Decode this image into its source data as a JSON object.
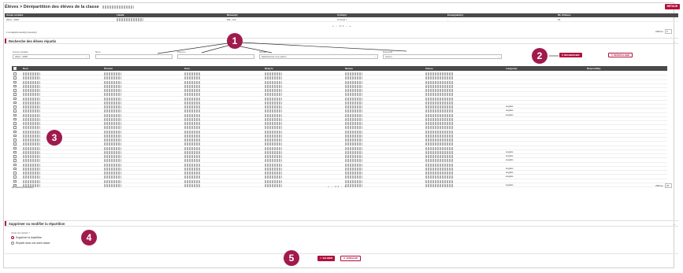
{
  "title": "Élèves > Dérépartition des élèves de la classe",
  "retour_label": "RETOUR",
  "class_grid": {
    "headers": [
      "Année scolaire",
      "Libellé",
      "Niveau(x)",
      "Cycle(s)",
      "Enseignant(s)",
      "Nb d'élèves"
    ],
    "row": [
      "2024 - 2025",
      "",
      "MS - GS",
      "CYCLE I",
      "-",
      "25"
    ]
  },
  "class_pager": {
    "first": "«",
    "prev": "‹",
    "page": "1 / 1",
    "next": "›",
    "last": "»"
  },
  "records_count": "1 enregistrement(s) trouvé(s)",
  "afficher_label": "Afficher",
  "afficher_value_top": "5",
  "search_section": {
    "title": "Recherche des élèves répartis",
    "fields": {
      "annee_label": "Année scolaire",
      "annee_value": "2024 - 2025",
      "nom_label": "Nom",
      "prenom_label": "Prénom",
      "niveau_label": "Niveau",
      "niveau_placeholder": "Sélectionner une option",
      "dispositif_label": "Dispositif",
      "dispositif_value": "Aucun"
    },
    "search_button": "RECHERCHER",
    "reset_button": "RÉINITIALISER"
  },
  "students_table": {
    "headers": [
      "Nom",
      "Prénom",
      "Sexe",
      "Né(e) le",
      "Niveau",
      "Classe",
      "Langue(s)",
      "Dispositif(s)"
    ],
    "languages": [
      "",
      "",
      "",
      "",
      "",
      "",
      "",
      "",
      "anglais",
      "anglais",
      "anglais",
      "",
      "",
      "",
      "",
      "",
      "",
      "",
      "",
      "anglais",
      "anglais",
      "anglais",
      "",
      "anglais",
      "anglais",
      "anglais",
      "",
      "anglais"
    ],
    "count_label": "28 élève(s) trouvé(s)",
    "afficher_value": "30"
  },
  "students_pager": {
    "first": "«",
    "prev": "‹",
    "page": "1 / 1",
    "next": "›",
    "last": "»"
  },
  "modify_section": {
    "title": "Supprimer ou modifier la répartition",
    "choice_label": "Choix de l'action *",
    "option_1": "Supprimer la répartition",
    "option_2": "Répartir dans une autre classe"
  },
  "actions": {
    "valider": "VALIDER",
    "annuler": "ANNULER"
  },
  "callouts": [
    "1",
    "2",
    "3",
    "4",
    "5"
  ],
  "colors": {
    "accent": "#b0113e",
    "callout": "#a01a4c",
    "header_dark": "#4a4a4a"
  }
}
